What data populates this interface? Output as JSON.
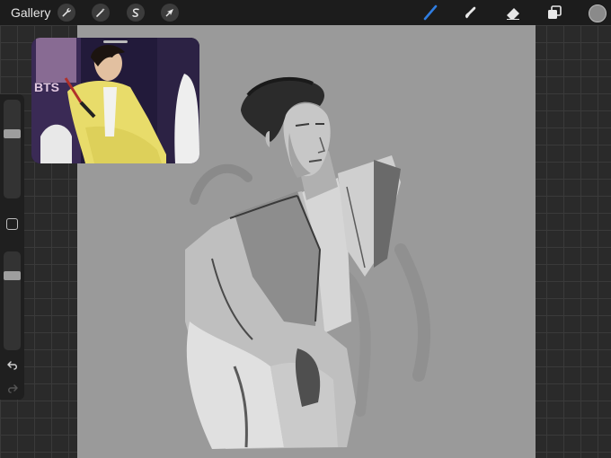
{
  "toolbar": {
    "gallery_label": "Gallery",
    "left_tools": [
      "actions-wrench",
      "adjustments-wand",
      "selection-s",
      "transform-arrow"
    ],
    "right_tools": [
      "brush",
      "smudge",
      "eraser",
      "layers"
    ],
    "active_tool": "brush",
    "accent_color": "#2f7de1",
    "current_color": "#8a8a8a"
  },
  "canvas": {
    "background_color": "#9a9a9a"
  },
  "reference": {
    "visible_text": "BTS"
  },
  "sidebar": {
    "brush_size_level": 0.33,
    "opacity_level": 0.22
  }
}
